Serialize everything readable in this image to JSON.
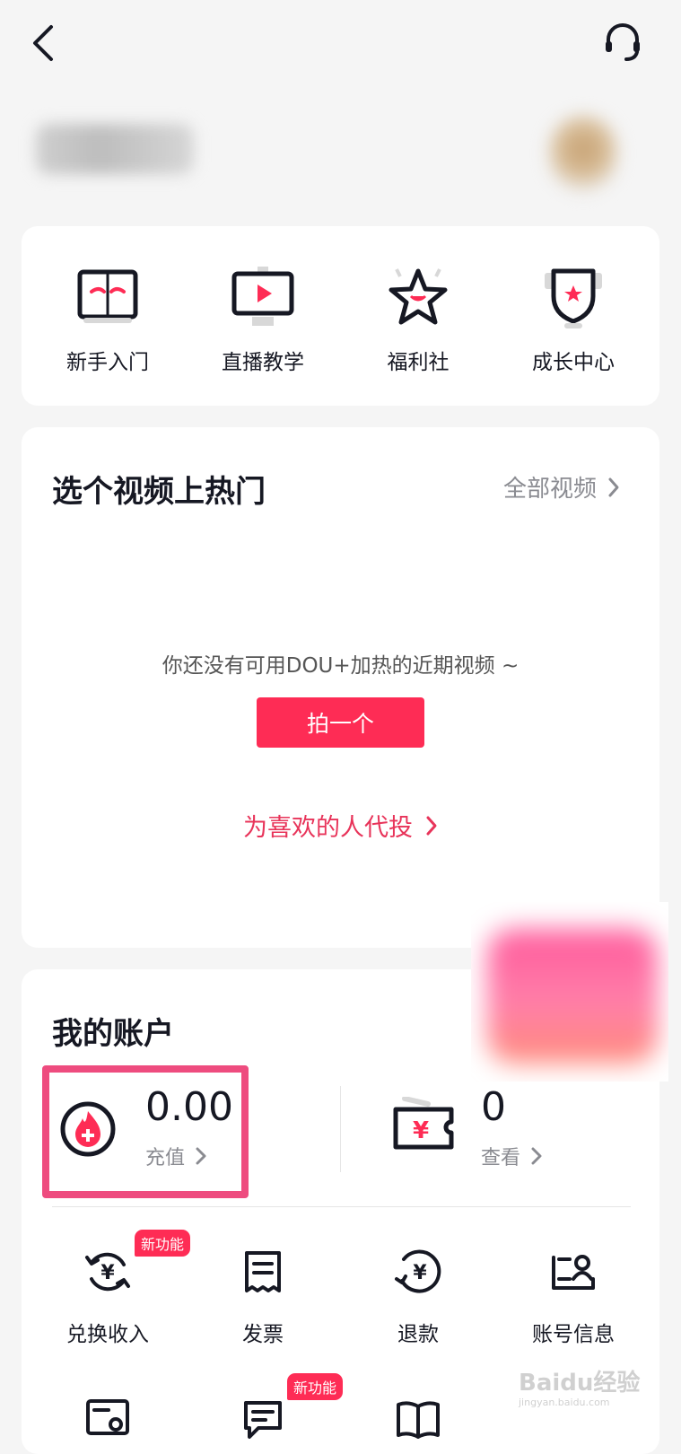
{
  "header": {},
  "quick_menu": [
    {
      "label": "新手入门",
      "icon": "book-icon"
    },
    {
      "label": "直播教学",
      "icon": "live-screen-icon"
    },
    {
      "label": "福利社",
      "icon": "star-icon"
    },
    {
      "label": "成长中心",
      "icon": "shield-icon"
    }
  ],
  "hot_video": {
    "title": "选个视频上热门",
    "all_videos_label": "全部视频",
    "empty_text": "你还没有可用DOU+加热的近期视频 ~",
    "shoot_button": "拍一个",
    "proxy_link": "为喜欢的人代投"
  },
  "account": {
    "title": "我的账户",
    "balance": "0.00",
    "recharge_label": "充值",
    "coupons": "0",
    "view_label": "查看"
  },
  "account_menu": [
    {
      "label": "兑换收入",
      "icon": "exchange-income-icon",
      "badge": "新功能"
    },
    {
      "label": "发票",
      "icon": "invoice-icon"
    },
    {
      "label": "退款",
      "icon": "refund-icon"
    },
    {
      "label": "账号信息",
      "icon": "account-info-icon"
    }
  ],
  "account_menu_row2": [
    {
      "icon": "certificate-icon"
    },
    {
      "icon": "message-icon",
      "badge": "新功能"
    },
    {
      "icon": "open-book-icon"
    }
  ],
  "watermark": {
    "text": "Baidu经验",
    "sub": "jingyan.baidu.com"
  },
  "colors": {
    "accent": "#fe2c55",
    "background": "#f5f5f5",
    "text": "#161823",
    "highlight_border": "#ee4c7f"
  }
}
